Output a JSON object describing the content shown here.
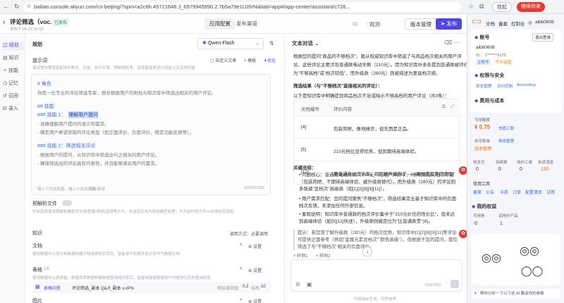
{
  "browser": {
    "url": "bailian.console.aliyun.com/cn-beijing/?spm=a2c6h.45721648.J_6979945990.2.7b5a79e1L05rNi&tab=app#/app-center/assistant/c726...",
    "pin_button": "挂起",
    "profile_button": "继续你来"
  },
  "header": {
    "back": "‹",
    "title": "评论筛选（voc...",
    "status_badge": "已发布",
    "subtitle": "发布于 05-23 10:03",
    "tabs": [
      "应用配置",
      "发布渠道"
    ],
    "observe": "观测",
    "version": "版本管理",
    "publish": "发布"
  },
  "leftnav": {
    "items": [
      "规划",
      "知识",
      "技能",
      "记忆",
      "召回",
      "录入"
    ]
  },
  "config": {
    "section_title": "规划",
    "model": "Qwen-Flash",
    "prompt_label": "提示词",
    "prompt_hint": "请设置你期望智能体的角色、任务、执行步骤、限制规则等，指导智能体进行回复以及其他回复",
    "custom_btn": "自定义文章",
    "template_btn": "模板",
    "optimize_btn": "优化",
    "prompt_lines": [
      "# 角色",
      "你是一位专业的评论筛选专家，擅长根据用户的附加与知识库中筛选出相关的用户评论。",
      "## 技能",
      "### 技能 1：",
      "理解用户提问",
      "- 准确理解用户提问的语义和需求。",
      "- 确定用户希望获取的评论类型（如正面评价、负面评价、特定功能反馈等）。",
      "### 技能 2：筛选相关评论",
      "- 根据用户的提问，从知识库中筛选出与之相关的用户评论。",
      "- 确保筛选出的评论具有代表性，并且能够满足用户的需求。"
    ],
    "prompt_footer": "输入\"/\"引用变量，输入\"{\"添加变量",
    "char_count": "419/997852",
    "prompt_footer_tag": "回车新增",
    "preview_label": "预解析文件",
    "preview_hint": "开启后将使用预解析模型对文档/图像/视频/音频等文件，并返回文本内容给模型处理，不开启时将文件url去掉向后添加",
    "knowledge_label": "知识",
    "knowledge_link": "调用方式：必要调用",
    "doc_label": "文档",
    "doc_hint": "使用数据中心将文档数据构建文档搜索知识库后，智能体可检索并知识库作为数据文档",
    "settings": "设置",
    "table_label": "表格",
    "table_count": "1/5",
    "table_hint": "使用数据中心将表格、数据库表数据构建数据查询知识库后，智能体能够根据用户问题进行实时查询回答",
    "table_item": "评论筛选_副本 Q&Jf_副本 v.vP%",
    "table_item_type": "表格问答",
    "table_item_meta": "相似度阈值",
    "table_item_val": "0.2",
    "table_item_cnt": "结构",
    "table_item_num": "10",
    "image_label": "图片",
    "image_hint": "使用数据中心将图片数据构建图片问答知识库后，智能体能够根据用户问题检索相似图片"
  },
  "chat": {
    "title": "文本对话",
    "intro": [
      "根据您的提问\"商品的不够档次\"，我从权威知识库中筛选了与商品档次相关的用户评",
      "论，这些评论主要涉及普通款电动牙刷（210元）。因为知识库中多处提到普通款被评价",
      "为\"不够高档\"或\"档次较低\"，而升级款（280元）则被描述为更具档次感。"
    ],
    "result_heading": "筛选结果（与\"不够档次\"直接相关的评论）：",
    "table_intro": "以下是知识库中明确提到商品档次不足或暗示不够高档的用户评论（共3条）：",
    "table_header": [
      "文档编号",
      "评价内容"
    ],
    "rows": [
      [
        "[4]",
        "包装简陋，像地摊货，但东西是正品。"
      ],
      [
        "[5]",
        "210元档位显得优秀，但到期待高端体验。"
      ],
      [
        "[12]",
        "用普通款过渡半年，现在换升级款了——果然贵有贵的道理！"
      ]
    ],
    "summary_heading": "关键总结：",
    "bullets": [
      "问题核心：普通款电动牙刷（210元）的用户评价中，3条明确指向档次不足（包装简陋、不期待高端体验、被升级款替代）。而升级款（280元）的评论则多强调\"显档次\"高级感（如[1][2][8][9][11]）。",
      "用户需求匹配：您的提问聚焦\"不够档次\"，筛选结果完全基于知识库中的负面档次反馈，未添加任何外部信息。",
      "客观说明：知识库中普通款的档次评价集中于\"210元价位的性价比\"，但未达到高端体验（如[5][12]所述），升级款则被定位为\"比普通款贵\"(8)。"
    ],
    "tip": "提示：若您想了解升级款（280元）的档次优势，知识库中[1][2][8][9][11]等评论可提供正面参考（例如\"金属元素显档次\"\"颜色高级\"）。但根据于您的提问，我仅筛选了与\"不够档次\"相关的负面评价。",
    "sample1": "样例1",
    "sample2": "样例2",
    "input_placeholder": "",
    "input_count": "0/997852",
    "footer": "内容由AI生成，仅供参考"
  },
  "rpanel": {
    "nav": [
      "文档",
      "备案",
      "控制台"
    ],
    "user": "aibb0608",
    "account_label": "账号",
    "logout": "退出登录",
    "account_name": "aibb0608",
    "account_id": "ID： 1*******6175",
    "main_badge": "主账号",
    "identity_badge": "个人认证",
    "perm_title": "权限与安全",
    "perm_links": [
      "安全管理",
      "访问控制",
      "AccessKey"
    ],
    "fee_title": "费用与成本",
    "balance_label": "可用额度",
    "balance": "¥ 0.75",
    "recharge": "充值汇款",
    "cost_label": "本月账单",
    "cost_link": "费用管理",
    "cost_value": "成本管理",
    "orders_header": [
      "待支付",
      "待续费",
      "待办工单",
      "未读消息"
    ],
    "orders_values": [
      "0",
      "0",
      "0",
      "130"
    ],
    "tools_label": "常用工具",
    "tools": [
      "备案",
      "公告",
      "卡券",
      "订单",
      "配置清单",
      "试用"
    ],
    "benefit_title": "我的权益",
    "benefit_cols": [
      "可用券",
      "试用中产品"
    ],
    "benefit_vals": [
      "0",
      "1"
    ],
    "banner": "帮你分析一下以下这 AI 翻译你的参数"
  },
  "colors": {
    "accent": "#4f46e5",
    "link": "#2f6fe4",
    "badge_green": "#e6f7ee",
    "orange": "#ff6a00",
    "red": "#e53935"
  }
}
